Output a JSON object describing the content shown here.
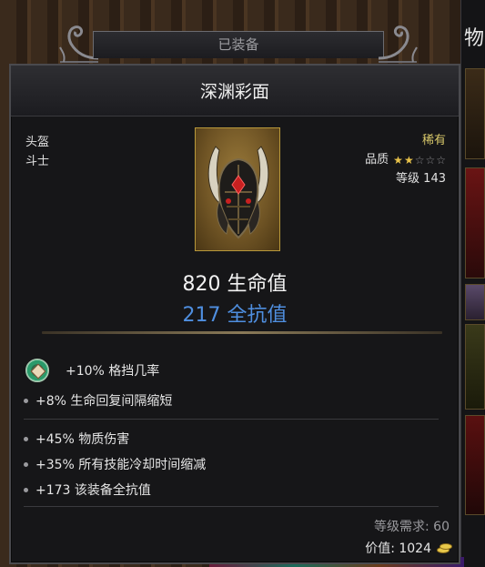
{
  "background": {
    "right_panel_title": "物"
  },
  "header": {
    "tab_label": "已装备"
  },
  "item": {
    "name": "深渊彩面",
    "slot": "头盔",
    "class": "斗士",
    "rarity": "稀有",
    "quality_label": "品质",
    "quality_stars": 2,
    "quality_max": 5,
    "item_level": "等级 143",
    "icon": "helmet-icon",
    "primary_stat": "820 生命值",
    "secondary_stat": "217 全抗值"
  },
  "gem": {
    "icon": "gem-icon",
    "text": "+10% 格挡几率"
  },
  "affixes": [
    {
      "text": "+8% 生命回复间隔缩短",
      "color": "white"
    },
    {
      "text": "+45% 物质伤害",
      "color": "blue"
    },
    {
      "text": "+35% 所有技能冷却时间缩减",
      "color": "blue"
    },
    {
      "text": "+173 该装备全抗值",
      "color": "blue"
    }
  ],
  "footer": {
    "requirement": "等级需求: 60",
    "price": "价值: 1024",
    "currency_icon": "gold-coins-icon"
  },
  "colors": {
    "rarity": "#d8c86a",
    "magic_affix": "#5b96e4",
    "star_filled": "#e8c24a",
    "frame_gold": "#b8983a"
  }
}
